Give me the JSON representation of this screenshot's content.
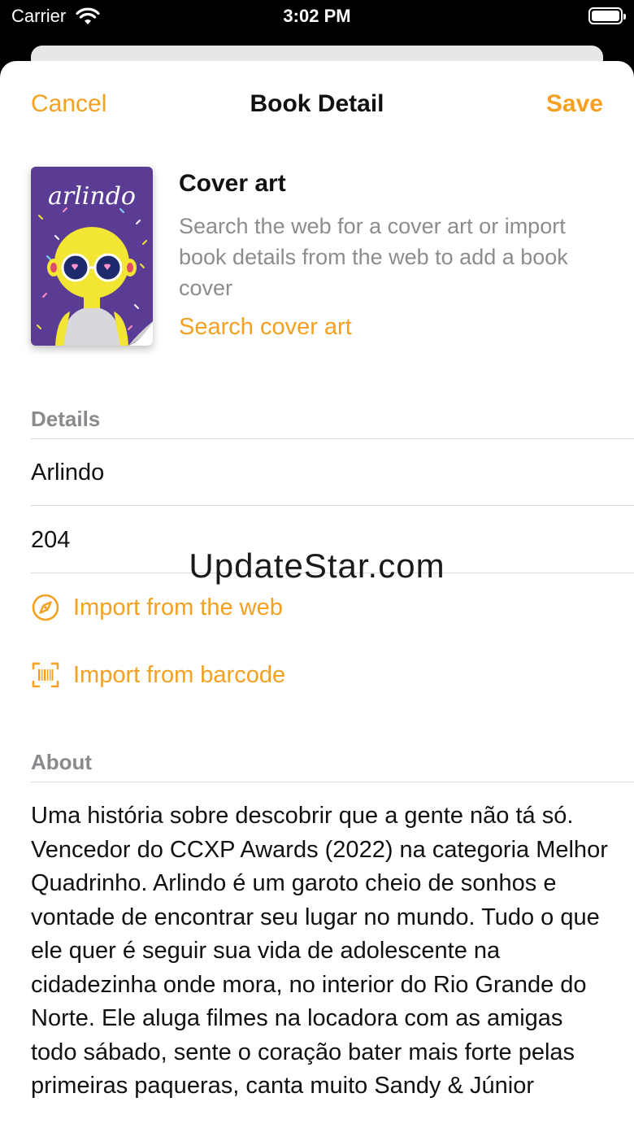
{
  "status_bar": {
    "carrier": "Carrier",
    "time": "3:02 PM"
  },
  "nav": {
    "cancel_label": "Cancel",
    "title": "Book Detail",
    "save_label": "Save"
  },
  "cover_art": {
    "title": "Cover art",
    "description": "Search the web for a cover art or import book details from the web to add a book cover",
    "search_link": "Search cover art",
    "book_cover_text": "arlindo"
  },
  "details": {
    "header": "Details",
    "title_value": "Arlindo",
    "pages_value": "204",
    "import_web_label": "Import from the web",
    "import_barcode_label": "Import from barcode"
  },
  "watermark": "UpdateStar.com",
  "about": {
    "header": "About",
    "text": "Uma história sobre descobrir que a gente não tá só. Vencedor do CCXP Awards (2022) na categoria Melhor Quadrinho. Arlindo é um garoto cheio de sonhos e vontade de encontrar seu lugar no mundo. Tudo o que ele quer é seguir sua vida de adolescente na cidadezinha onde mora, no interior do Rio Grande do Norte. Ele aluga filmes na locadora com as amigas todo sábado, sente o coração bater mais forte pelas primeiras paqueras, canta muito Sandy & Júnior"
  },
  "colors": {
    "accent": "#f4a020",
    "secondary_text": "#8c8c91",
    "cover_purple": "#5a3c95",
    "cover_yellow": "#f2e534"
  }
}
